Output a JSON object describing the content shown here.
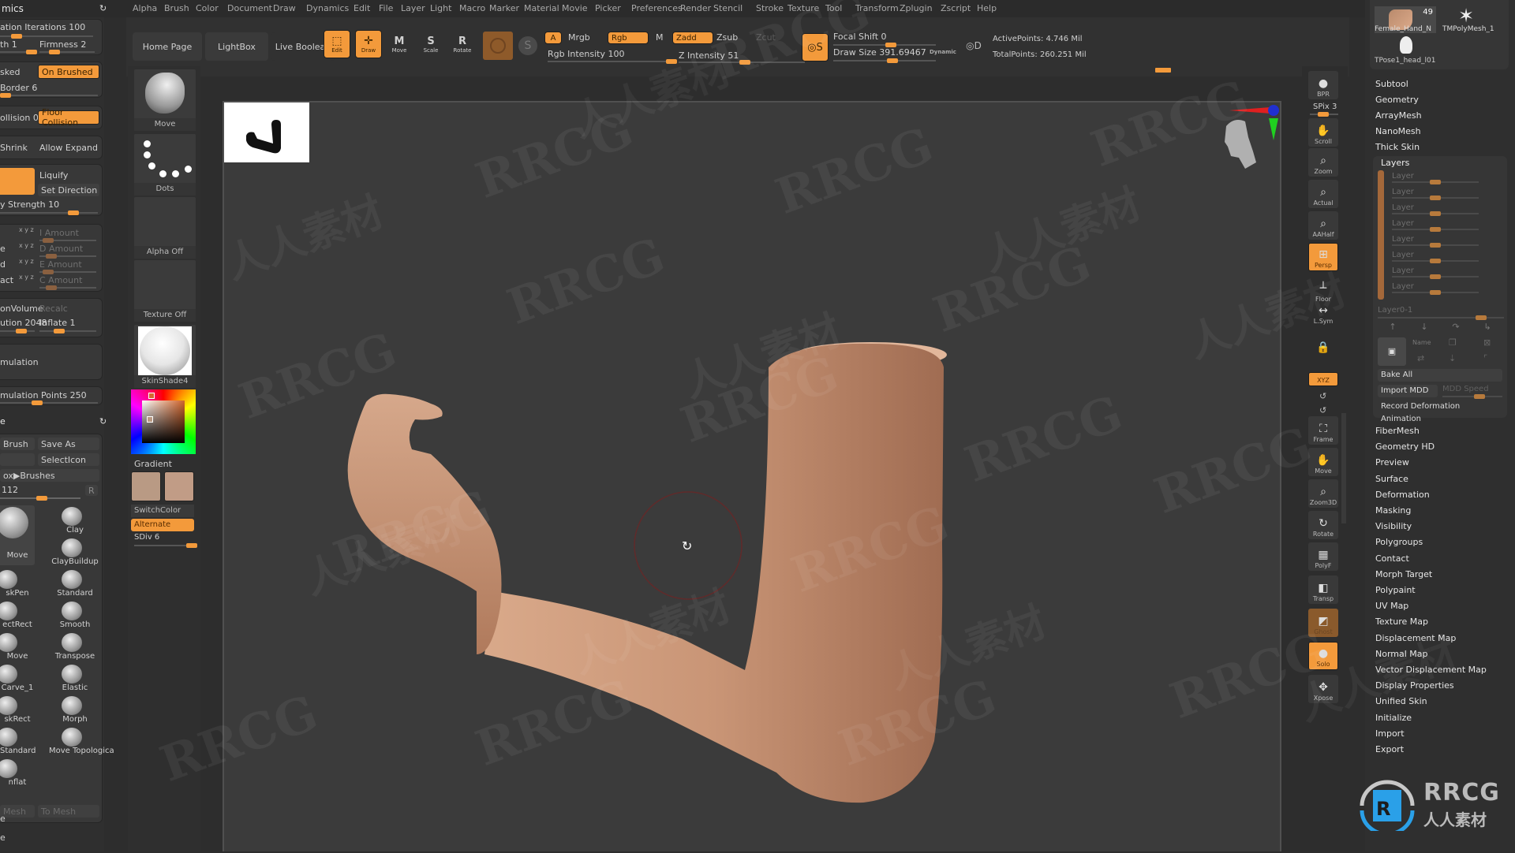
{
  "menu": [
    "Alpha",
    "Brush",
    "Color",
    "Document",
    "Draw",
    "Dynamics",
    "Edit",
    "File",
    "Layer",
    "Light",
    "Macro",
    "Marker",
    "Material",
    "Movie",
    "Picker",
    "Preferences",
    "Render",
    "Stencil",
    "Stroke",
    "Texture",
    "Tool",
    "Transform",
    "Zplugin",
    "Zscript",
    "Help"
  ],
  "topbar": {
    "home_page": "Home Page",
    "lightbox": "LightBox",
    "live_boolean": "Live Boolean",
    "edit": "Edit",
    "draw": "Draw",
    "move": "Move",
    "scale": "Scale",
    "rotate": "Rotate",
    "a": "A",
    "mrgb": "Mrgb",
    "rgb": "Rgb",
    "m": "M",
    "zadd": "Zadd",
    "zsub": "Zsub",
    "zcut": "Zcut",
    "rgb_intensity": "Rgb Intensity 100",
    "z_intensity": "Z Intensity 51",
    "focal_shift": "Focal Shift 0",
    "draw_size": "Draw Size 391.69467",
    "dynamic": "Dynamic",
    "active_points": "ActivePoints: 4.746 Mil",
    "total_points": "TotalPoints: 260.251 Mil",
    "rgb_intensity_value": 100,
    "z_intensity_value": 51
  },
  "left_panel": {
    "title": "mics",
    "iterations": "ation Iterations 100",
    "length": "th 1",
    "firmness": "Firmness 2",
    "masked": "sked",
    "on_brushed": "On Brushed",
    "border": "Border 6",
    "collision": "ollision 0",
    "floor_collision": "Floor Collision",
    "shrink": "Shrink",
    "allow_expand": "Allow Expand",
    "liquify": "Liquify",
    "set_direction": "Set Direction",
    "strength": "y Strength 10",
    "amounts": [
      {
        "left": "",
        "xyz": "x y z",
        "label": "I Amount"
      },
      {
        "left": "e",
        "xyz": "x y z",
        "label": "D Amount"
      },
      {
        "left": "d",
        "xyz": "x y z",
        "label": "E Amount"
      },
      {
        "left": "act",
        "xyz": "x y z",
        "label": "C Amount"
      }
    ],
    "on_volume": "onVolume",
    "recalc": "Recalc",
    "resolution": "ution 2048",
    "inflate": "Inflate 1",
    "simulation": "mulation",
    "simulation_points": "mulation Points 250",
    "brush_label": "Brush",
    "save_as": "Save As",
    "select_icon": "SelectIcon",
    "to_brushes": "ox▶Brushes",
    "count": "112",
    "r": "R",
    "brushes": [
      {
        "name": "Move",
        "col": 0
      },
      {
        "name": "Clay",
        "col": 1
      },
      {
        "name": "ClayBuildup",
        "col": 1
      },
      {
        "name": "skPen",
        "col": 0
      },
      {
        "name": "Standard",
        "col": 1
      },
      {
        "name": "ectRect",
        "col": 0
      },
      {
        "name": "Smooth",
        "col": 1
      },
      {
        "name": "Move",
        "col": 0
      },
      {
        "name": "Transpose",
        "col": 1
      },
      {
        "name": "Carve_1",
        "col": 0
      },
      {
        "name": "Elastic",
        "col": 1
      },
      {
        "name": "skRect",
        "col": 0
      },
      {
        "name": "Morph",
        "col": 1
      },
      {
        "name": "Standard",
        "col": 0
      },
      {
        "name": "Move Topologica",
        "col": 1
      },
      {
        "name": "nflat",
        "col": 0
      }
    ],
    "mesh": "Mesh",
    "to_mesh": "To Mesh",
    "bottom_labels": [
      "e",
      "e"
    ]
  },
  "col2": {
    "brush": "Move",
    "stroke": "Dots",
    "alpha": "Alpha Off",
    "texture": "Texture Off",
    "material": "SkinShade4",
    "gradient": "Gradient",
    "switch_color": "SwitchColor",
    "alternate": "Alternate",
    "sdiv": "SDiv 6",
    "main_color": "#b99a84",
    "secondary_color": "#c19c86"
  },
  "right_toolbar": [
    {
      "name": "bpr",
      "label": "BPR",
      "state": "normal"
    },
    {
      "name": "spix",
      "label": "SPix 3",
      "state": "slider"
    },
    {
      "name": "scroll",
      "label": "Scroll",
      "state": "normal"
    },
    {
      "name": "zoom",
      "label": "Zoom",
      "state": "normal"
    },
    {
      "name": "actual",
      "label": "Actual",
      "state": "normal"
    },
    {
      "name": "aahalf",
      "label": "AAHalf",
      "state": "normal"
    },
    {
      "name": "persp",
      "label": "Persp",
      "state": "on"
    },
    {
      "name": "floor",
      "label": "Floor",
      "state": "flat"
    },
    {
      "name": "lsym",
      "label": "L.Sym",
      "state": "flat"
    },
    {
      "name": "lock",
      "label": "",
      "state": "flat"
    },
    {
      "name": "xyz",
      "label": "XYZ",
      "state": "on"
    },
    {
      "name": "frame",
      "label": "Frame",
      "state": "normal"
    },
    {
      "name": "move",
      "label": "Move",
      "state": "normal"
    },
    {
      "name": "zoom3d",
      "label": "Zoom3D",
      "state": "normal"
    },
    {
      "name": "rotate",
      "label": "Rotate",
      "state": "normal"
    },
    {
      "name": "polyf",
      "label": "PolyF",
      "state": "normal"
    },
    {
      "name": "transp",
      "label": "Transp",
      "state": "normal"
    },
    {
      "name": "ghost",
      "label": "Ghost",
      "state": "dimon"
    },
    {
      "name": "solo",
      "label": "Solo",
      "state": "on"
    },
    {
      "name": "xpose",
      "label": "Xpose",
      "state": "normal"
    }
  ],
  "right_panel": {
    "subtools": [
      {
        "name": "Female_Hand_N",
        "badge": "49"
      },
      {
        "name": "TMPolyMesh_1",
        "badge": ""
      },
      {
        "name": "TPose1_head_l01",
        "badge": ""
      }
    ],
    "top_items": [
      "Subtool",
      "Geometry",
      "ArrayMesh",
      "NanoMesh",
      "Thick Skin"
    ],
    "layers_title": "Layers",
    "layers": [
      "Layer",
      "Layer",
      "Layer",
      "Layer",
      "Layer",
      "Layer",
      "Layer",
      "Layer"
    ],
    "layer_active": "Layer0-1",
    "name_btn": "Name",
    "bake_all": "Bake All",
    "import_mdd": "Import MDD",
    "mdd_speed": "MDD Speed",
    "record": "Record Deformation Animation",
    "bottom_items": [
      "FiberMesh",
      "Geometry HD",
      "Preview",
      "Surface",
      "Deformation",
      "Masking",
      "Visibility",
      "Polygroups",
      "Contact",
      "Morph Target",
      "Polypaint",
      "UV Map",
      "Texture Map",
      "Displacement Map",
      "Normal Map",
      "Vector Displacement Map",
      "Display Properties",
      "Unified Skin",
      "Initialize",
      "Import",
      "Export"
    ]
  },
  "watermark": {
    "text": "RRCG",
    "cn": "人人素材"
  },
  "logo": {
    "text": "RRCG",
    "sub": "人人素材"
  },
  "colors": {
    "accent": "#f39a3b",
    "skin": "#c99576",
    "bg": "#3b3b3b"
  }
}
